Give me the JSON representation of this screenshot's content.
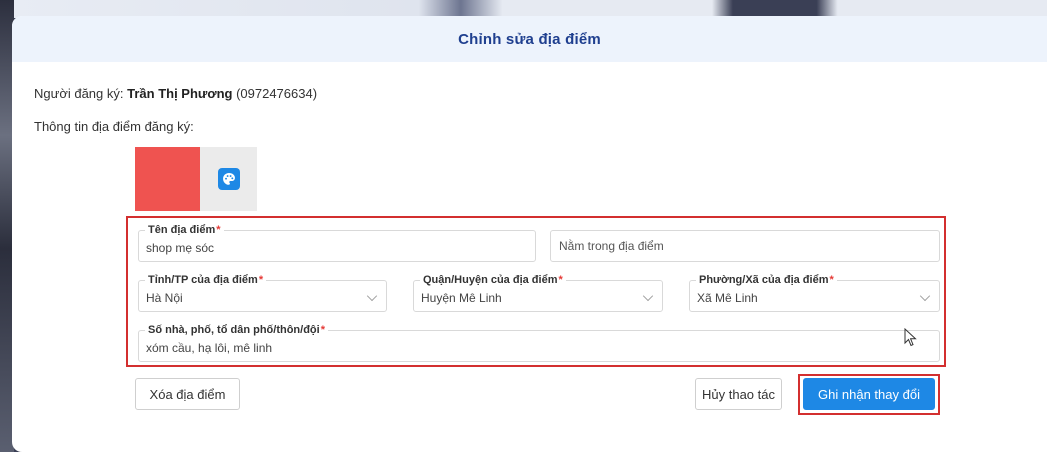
{
  "modal": {
    "title": "Chỉnh sửa địa điểm"
  },
  "registrant": {
    "label": "Người đăng ký:",
    "name": "Trần Thị Phương",
    "phone": "(0972476634)"
  },
  "info_label": "Thông tin địa điểm đăng ký:",
  "color": {
    "selected": "#ef5350",
    "picker_icon": "palette-icon"
  },
  "form": {
    "place_name": {
      "label": "Tên địa điểm",
      "value": "shop mẹ sóc"
    },
    "parent_place": {
      "placeholder": "Nằm trong địa điểm"
    },
    "province": {
      "label": "Tỉnh/TP của địa điểm",
      "value": "Hà Nội"
    },
    "district": {
      "label": "Quận/Huyện của địa điểm",
      "value": "Huyện Mê Linh"
    },
    "ward": {
      "label": "Phường/Xã của địa điểm",
      "value": "Xã Mê Linh"
    },
    "address": {
      "label": "Số nhà, phố, tổ dân phố/thôn/đội",
      "value": "xóm cầu, hạ lôi, mê linh"
    },
    "required_mark": "*"
  },
  "buttons": {
    "delete": "Xóa địa điểm",
    "cancel": "Hủy thao tác",
    "save": "Ghi nhận thay đổi"
  },
  "colors": {
    "accent": "#1e88e5",
    "highlight": "#d32f2f",
    "title": "#1f3f8f",
    "header_bg": "#edf3fc"
  }
}
